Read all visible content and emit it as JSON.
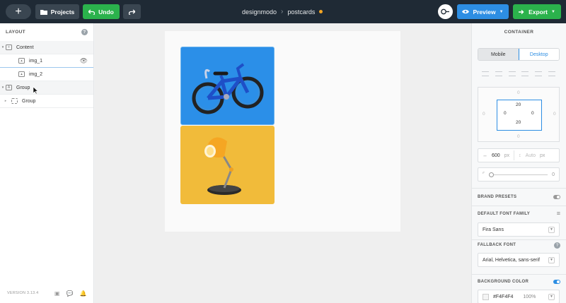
{
  "topbar": {
    "projects_label": "Projects",
    "undo_label": "Undo",
    "breadcrumb_workspace": "designmodo",
    "breadcrumb_separator": "›",
    "breadcrumb_project": "postcards",
    "preview_label": "Preview",
    "export_label": "Export",
    "colors": {
      "bar": "#1f2a35",
      "green": "#2bb24c",
      "blue": "#2d8ee3",
      "unsaved_dot": "#f5a623"
    }
  },
  "layout_panel": {
    "title": "LAYOUT",
    "help_icon": "?",
    "rows": [
      {
        "label": "Content",
        "type": "section"
      },
      {
        "label": "img_1",
        "type": "image"
      },
      {
        "label": "img_2",
        "type": "image"
      },
      {
        "label": "Group",
        "type": "section"
      },
      {
        "label": "Group",
        "type": "group"
      }
    ],
    "version": "VERSION 3.13.4"
  },
  "canvas": {
    "tiles": [
      {
        "name": "img_1",
        "content": "bicycle",
        "color": "#2b8fe8"
      },
      {
        "name": "img_2",
        "content": "desk-lamp",
        "color": "#f1bb3a"
      }
    ]
  },
  "right_panel": {
    "title": "CONTAINER",
    "device_mobile": "Mobile",
    "device_desktop": "Desktop",
    "margin": {
      "top": "0",
      "right": "0",
      "bottom": "0",
      "left": "0"
    },
    "padding": {
      "top": "20",
      "right": "0",
      "bottom": "20",
      "left": "0"
    },
    "width_value": "600",
    "width_unit": "px",
    "height_value": "Auto",
    "height_unit": "px",
    "radius_value": "0",
    "brand_presets_label": "BRAND PRESETS",
    "default_font_label": "DEFAULT FONT FAMILY",
    "default_font_value": "Fira Sans",
    "fallback_font_label": "FALLBACK FONT",
    "fallback_font_value": "Arial, Helvetica, sans-serif",
    "background_color_label": "BACKGROUND COLOR",
    "background_color_value": "#F4F4F4",
    "background_opacity": "100%"
  }
}
